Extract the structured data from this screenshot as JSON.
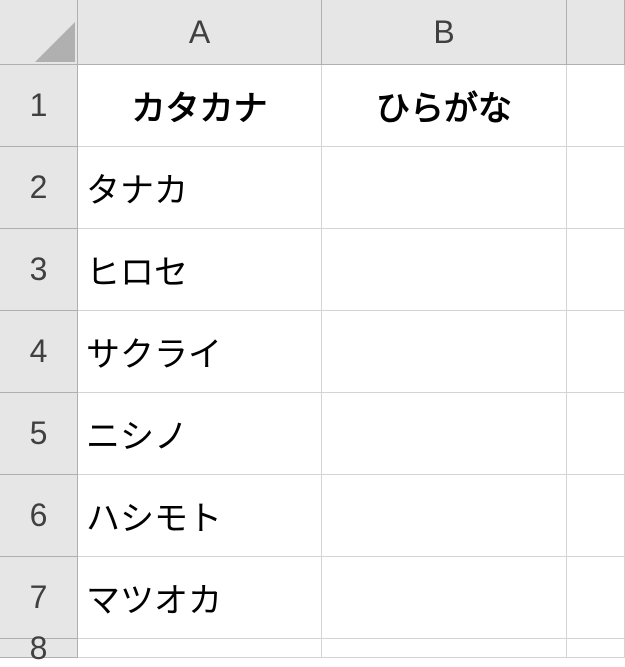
{
  "columns": [
    "A",
    "B"
  ],
  "rows": [
    "1",
    "2",
    "3",
    "4",
    "5",
    "6",
    "7",
    "8"
  ],
  "headers": {
    "A": "カタカナ",
    "B": "ひらがな"
  },
  "data": {
    "A2": "タナカ",
    "A3": "ヒロセ",
    "A4": "サクライ",
    "A5": "ニシノ",
    "A6": "ハシモト",
    "A7": "マツオカ"
  },
  "chart_data": {
    "type": "table",
    "title": "",
    "columns": [
      "カタカナ",
      "ひらがな"
    ],
    "rows": [
      [
        "タナカ",
        ""
      ],
      [
        "ヒロセ",
        ""
      ],
      [
        "サクライ",
        ""
      ],
      [
        "ニシノ",
        ""
      ],
      [
        "ハシモト",
        ""
      ],
      [
        "マツオカ",
        ""
      ]
    ]
  }
}
